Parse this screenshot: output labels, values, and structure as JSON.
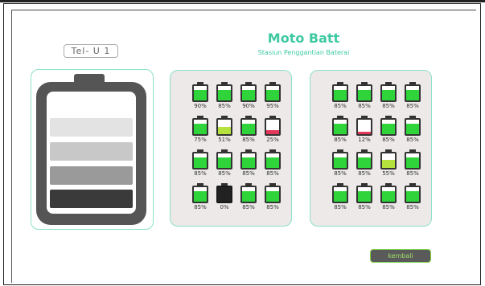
{
  "header": {
    "device_label": "Tel- U 1",
    "title": "Moto Batt",
    "subtitle": "Stasiun  Penggantian Baterai"
  },
  "colors": {
    "accent": "#3ec9a2",
    "full": "#2fd33a",
    "medium": "#b6e23d",
    "low": "#e2395a"
  },
  "main_battery": {
    "level_colors": [
      "#e3e3e3",
      "#c8c8c8",
      "#9a9a9a",
      "#3a3a3a"
    ]
  },
  "left_grid": [
    [
      "90%",
      "85%",
      "90%",
      "95%"
    ],
    [
      "75%",
      "51%",
      "85%",
      "25%"
    ],
    [
      "85%",
      "85%",
      "85%",
      "85%"
    ],
    [
      "85%",
      "0%",
      "85%",
      "85%"
    ]
  ],
  "right_grid": [
    [
      "85%",
      "85%",
      "85%",
      "85%"
    ],
    [
      "85%",
      "12%",
      "85%",
      "85%"
    ],
    [
      "85%",
      "85%",
      "55%",
      "85%"
    ],
    [
      "85%",
      "85%",
      "85%",
      "85%"
    ]
  ],
  "footer": {
    "back_button": "kembali"
  }
}
